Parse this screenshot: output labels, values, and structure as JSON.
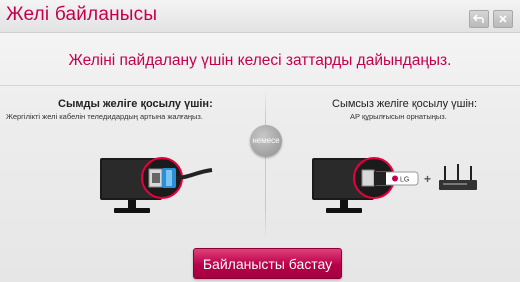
{
  "window": {
    "title": "Желі байланысы",
    "back_icon": "back-icon",
    "close_icon": "close-icon"
  },
  "instruction": "Желіні пайдалану үшін келесі заттарды дайындаңыз.",
  "wired": {
    "title": "Сымды желіге қосылу үшін:",
    "description": "Жергілікті желі кабелін теледидардың артына жалғаңыз."
  },
  "or_label": "немесе",
  "wireless": {
    "title": "Сымсыз желіге қосылу үшін:",
    "description": "AP құрылғысын орнатыңыз.",
    "dongle_label": "LG",
    "plus_sign": "+"
  },
  "start_button": "Байланысты бастау",
  "colors": {
    "accent": "#c4004e",
    "button": "#b8004a"
  }
}
